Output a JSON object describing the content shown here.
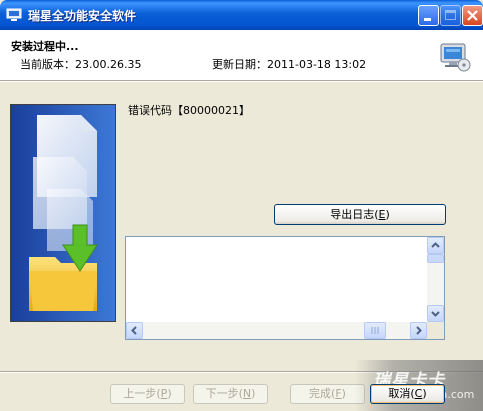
{
  "window": {
    "title": "瑞星全功能安全软件"
  },
  "header": {
    "title": "安装过程中...",
    "version": "当前版本：23.00.26.35",
    "update_date": "更新日期：2011-03-18 13:02"
  },
  "main": {
    "error_label": "错误代码【80000021】",
    "export_button": {
      "label": "导出日志(",
      "hotkey": "E",
      "suffix": ")"
    },
    "log_text": ""
  },
  "footer": {
    "prev": {
      "label": "上一步(",
      "hotkey": "P",
      "suffix": ")"
    },
    "next": {
      "label": "下一步(",
      "hotkey": "N",
      "suffix": ")"
    },
    "finish": {
      "label": "完成(",
      "hotkey": "F",
      "suffix": ")"
    },
    "cancel": {
      "label": "取消(",
      "hotkey": "C",
      "suffix": ")"
    }
  },
  "watermark": {
    "text": "瑞星卡卡",
    "url": "www.ikaka.com"
  },
  "colors": {
    "titlebar": "#0a5fd6",
    "dialog_bg": "#ece9d8",
    "side_panel": "#1a3a8c",
    "folder": "#f6c73a",
    "arrow": "#5bbf2a"
  }
}
